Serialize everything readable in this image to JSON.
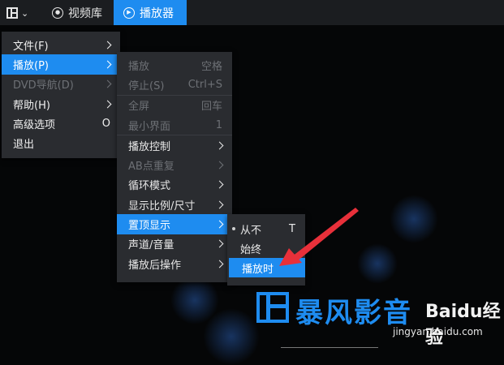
{
  "tabs": {
    "library": {
      "label": "视频库",
      "icon": "film-reel-icon"
    },
    "player": {
      "label": "播放器",
      "icon": "play-circle-icon"
    }
  },
  "main_menu": {
    "items": [
      {
        "label": "文件(F)",
        "submenu": true,
        "state": "normal"
      },
      {
        "label": "播放(P)",
        "submenu": true,
        "state": "active"
      },
      {
        "label": "DVD导航(D)",
        "submenu": true,
        "state": "disabled"
      },
      {
        "label": "帮助(H)",
        "submenu": true,
        "state": "normal"
      },
      {
        "label": "高级选项",
        "shortcut": "O",
        "state": "normal"
      },
      {
        "label": "退出",
        "state": "normal"
      }
    ]
  },
  "play_menu": {
    "items": [
      {
        "label": "播放",
        "shortcut": "空格",
        "state": "disabled"
      },
      {
        "label": "停止(S)",
        "shortcut": "Ctrl+S",
        "state": "disabled"
      },
      {
        "label": "全屏",
        "shortcut": "回车",
        "state": "disabled"
      },
      {
        "label": "最小界面",
        "shortcut": "1",
        "state": "disabled"
      },
      {
        "label": "播放控制",
        "submenu": true,
        "state": "normal"
      },
      {
        "label": "AB点重复",
        "submenu": true,
        "state": "disabled"
      },
      {
        "label": "循环模式",
        "submenu": true,
        "state": "normal"
      },
      {
        "label": "显示比例/尺寸",
        "submenu": true,
        "state": "normal"
      },
      {
        "label": "置顶显示",
        "submenu": true,
        "state": "active"
      },
      {
        "label": "声道/音量",
        "submenu": true,
        "state": "normal"
      },
      {
        "label": "播放后操作",
        "submenu": true,
        "state": "normal"
      }
    ]
  },
  "ontop_menu": {
    "items": [
      {
        "label": "从不",
        "shortcut": "T",
        "checked": true,
        "state": "normal"
      },
      {
        "label": "始终",
        "state": "normal"
      },
      {
        "label": "播放时",
        "state": "active"
      }
    ]
  },
  "branding": {
    "logo_text": "暴风影音",
    "watermark_brand": "Baidu经验",
    "watermark_url": "jingyan.baidu.com"
  },
  "colors": {
    "accent": "#1e8cf0",
    "menu_bg": "#2a2c30",
    "annotation_arrow": "#e8303a"
  }
}
